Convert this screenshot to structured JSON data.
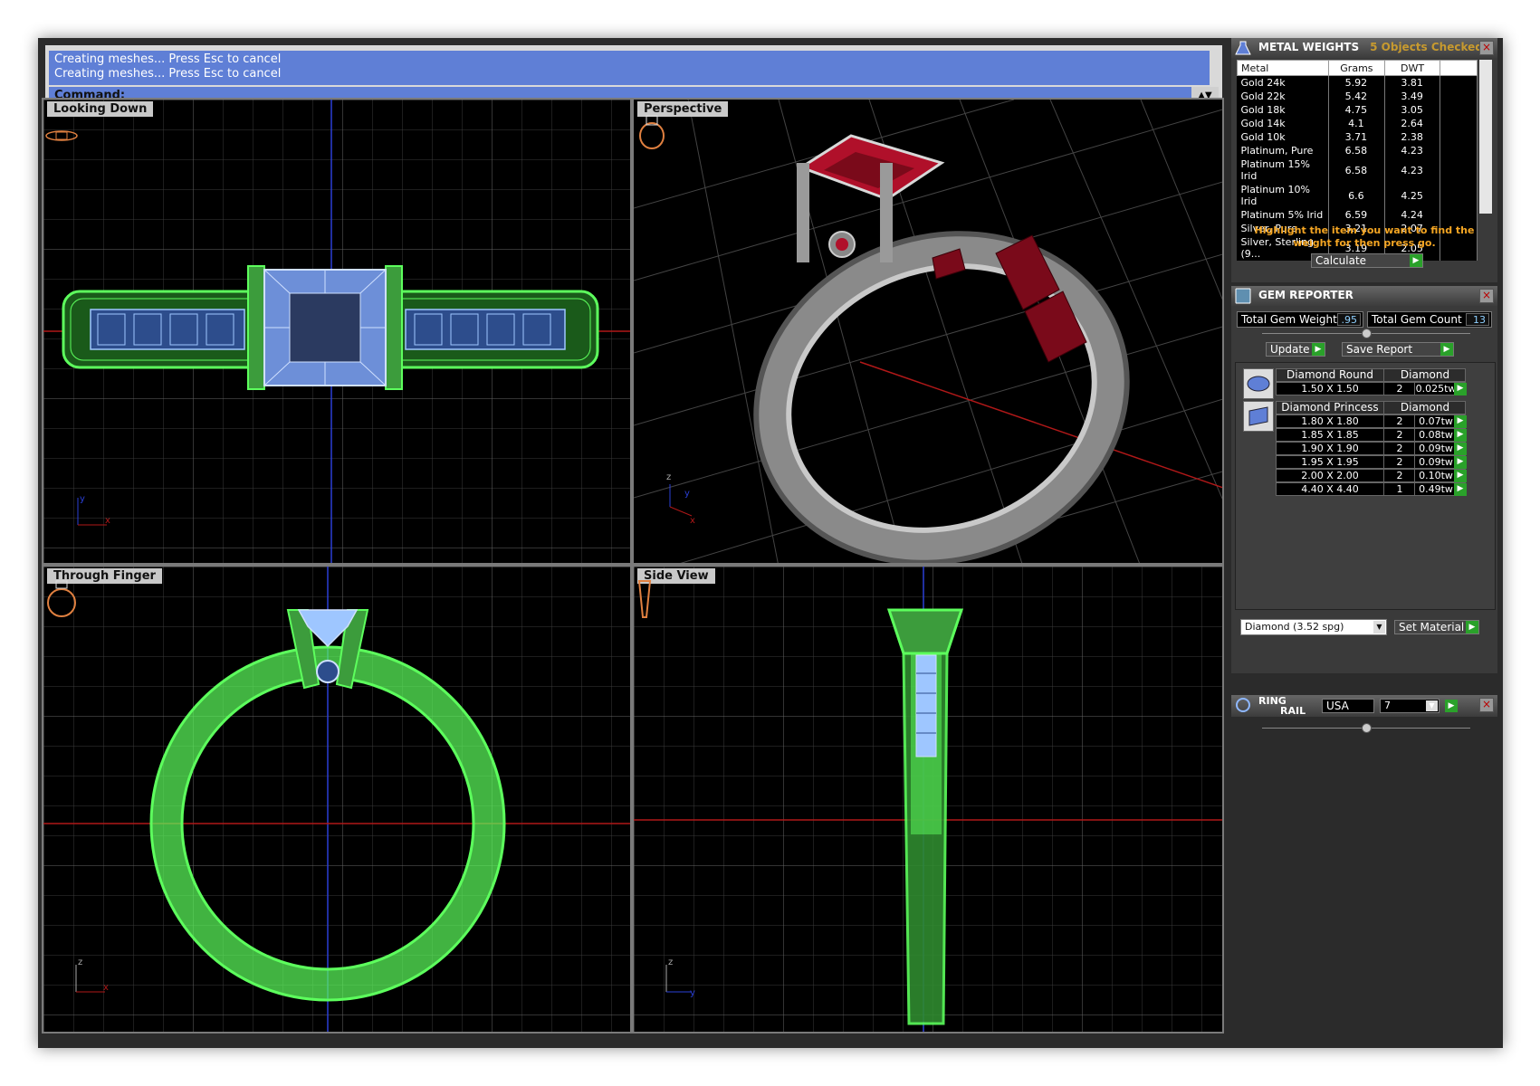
{
  "command": {
    "log": [
      "Creating meshes... Press Esc to cancel",
      "Creating meshes... Press Esc to cancel"
    ],
    "prompt": "Command:"
  },
  "viewports": {
    "top_left": "Looking Down",
    "top_right": "Perspective",
    "bottom_left": "Through Finger",
    "bottom_right": "Side View"
  },
  "metal_weights": {
    "title": "METAL WEIGHTS",
    "subtitle": "5 Objects Checked",
    "columns": [
      "Metal",
      "Grams",
      "DWT"
    ],
    "rows": [
      {
        "metal": "Gold 24k",
        "grams": "5.92",
        "dwt": "3.81"
      },
      {
        "metal": "Gold 22k",
        "grams": "5.42",
        "dwt": "3.49"
      },
      {
        "metal": "Gold 18k",
        "grams": "4.75",
        "dwt": "3.05"
      },
      {
        "metal": "Gold 14k",
        "grams": "4.1",
        "dwt": "2.64"
      },
      {
        "metal": "Gold 10k",
        "grams": "3.71",
        "dwt": "2.38"
      },
      {
        "metal": "Platinum, Pure",
        "grams": "6.58",
        "dwt": "4.23"
      },
      {
        "metal": "Platinum 15% Irid",
        "grams": "6.58",
        "dwt": "4.23"
      },
      {
        "metal": "Platinum 10% Irid",
        "grams": "6.6",
        "dwt": "4.25"
      },
      {
        "metal": "Platinum 5% Irid",
        "grams": "6.59",
        "dwt": "4.24"
      },
      {
        "metal": "Silver, Pure",
        "grams": "3.21",
        "dwt": "2.07"
      },
      {
        "metal": "Silver, Sterling (9...",
        "grams": "3.19",
        "dwt": "2.05"
      }
    ],
    "hint": "Highlight the item you want to find the weight for then press go.",
    "calculate": "Calculate"
  },
  "gem_reporter": {
    "title": "GEM REPORTER",
    "total_weight_label": "Total Gem Weight",
    "total_weight": ".95",
    "total_count_label": "Total Gem Count",
    "total_count": "13",
    "update": "Update",
    "save_report": "Save Report",
    "groups": [
      {
        "shape": "Diamond Round",
        "material": "Diamond",
        "rows": [
          {
            "size": "1.50 X 1.50",
            "qty": "2",
            "weight": "0.025tw"
          }
        ]
      },
      {
        "shape": "Diamond Princess",
        "material": "Diamond",
        "rows": [
          {
            "size": "1.80 X 1.80",
            "qty": "2",
            "weight": "0.07tw"
          },
          {
            "size": "1.85 X 1.85",
            "qty": "2",
            "weight": "0.08tw"
          },
          {
            "size": "1.90 X 1.90",
            "qty": "2",
            "weight": "0.09tw"
          },
          {
            "size": "1.95 X 1.95",
            "qty": "2",
            "weight": "0.09tw"
          },
          {
            "size": "2.00 X 2.00",
            "qty": "2",
            "weight": "0.10tw"
          },
          {
            "size": "4.40 X 4.40",
            "qty": "1",
            "weight": "0.49tw"
          }
        ]
      }
    ],
    "material_select": "Diamond    (3.52 spg)",
    "set_material": "Set Material"
  },
  "ring_rail": {
    "title_line1": "RING",
    "title_line2": "RAIL",
    "country": "USA",
    "size": "7"
  },
  "colors": {
    "command_bg": "#5f7fd6",
    "wire_green": "#5dff5d",
    "wire_blue": "#9ec6ff",
    "ruby": "#b0102a",
    "accent_orange": "#f5a623",
    "go_green": "#2aa12a"
  }
}
